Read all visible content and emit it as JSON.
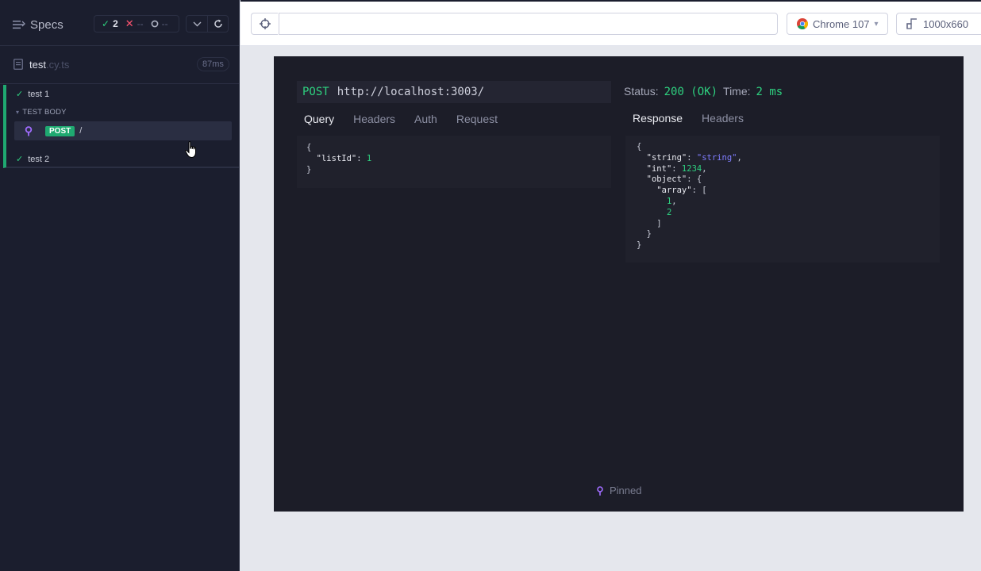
{
  "sidebar": {
    "specs_label": "Specs",
    "stats": {
      "passed": "2",
      "failed": "--",
      "pending": "--"
    },
    "file": {
      "name": "test",
      "ext": ".cy.ts",
      "duration": "87ms"
    },
    "tests": [
      {
        "title": "test 1",
        "body_label": "TEST BODY",
        "command": {
          "method": "POST",
          "path": "/"
        }
      },
      {
        "title": "test 2"
      }
    ]
  },
  "topbar": {
    "url_value": "",
    "browser": "Chrome 107",
    "viewport": "1000x660"
  },
  "aut": {
    "request": {
      "method": "POST",
      "url": "http://localhost:3003/"
    },
    "status_label": "Status:",
    "status_value": "200 (OK)",
    "time_label": "Time:",
    "time_value": "2 ms",
    "request_tabs": [
      "Query",
      "Headers",
      "Auth",
      "Request"
    ],
    "response_tabs": [
      "Response",
      "Headers"
    ],
    "query_body": {
      "listId": 1
    },
    "response_body": {
      "string": "string",
      "int": 1234,
      "object": {
        "array": [
          1,
          2
        ]
      }
    },
    "pinned_label": "Pinned"
  },
  "colors": {
    "accent_green": "#2ed07f",
    "pin_purple": "#a06cff",
    "sidebar_bg": "#1b1e2e"
  },
  "icons": [
    "specs-list-icon",
    "check-icon",
    "x-icon",
    "pending-icon",
    "chevron-down-icon",
    "reload-icon",
    "file-icon",
    "pin-icon",
    "crosshair-icon",
    "chrome-icon",
    "viewport-icon",
    "pointer-cursor-icon"
  ]
}
